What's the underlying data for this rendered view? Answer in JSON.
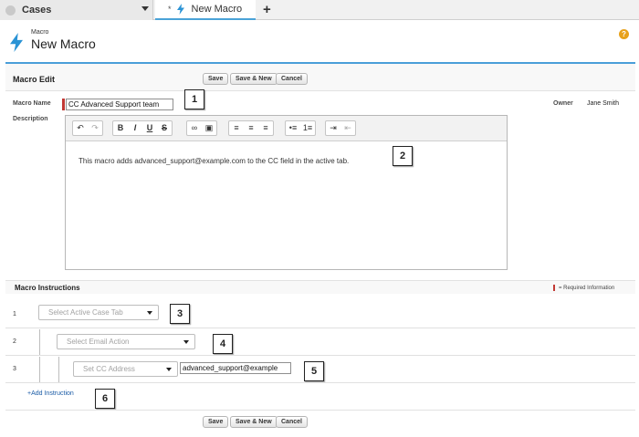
{
  "tabs": {
    "primary_label": "Cases",
    "subtab_modified_marker": "*",
    "subtab_label": "New Macro",
    "add_tab_symbol": "+"
  },
  "header": {
    "object_label": "Macro",
    "title": "New Macro",
    "help_symbol": "?"
  },
  "edit_section": {
    "title": "Macro Edit",
    "buttons": {
      "save": "Save",
      "save_new": "Save & New",
      "cancel": "Cancel"
    }
  },
  "fields": {
    "name_label": "Macro Name",
    "name_value": "CC Advanced Support team",
    "description_label": "Description",
    "owner_label": "Owner",
    "owner_value": "Jane Smith"
  },
  "editor": {
    "body_text": "This macro adds advanced_support@example.com to the CC field in the active tab.",
    "toolbar_icons": [
      "undo-icon",
      "redo-icon",
      "bold-icon",
      "italic-icon",
      "underline-icon",
      "strikethrough-icon",
      "link-icon",
      "image-icon",
      "align-left-icon",
      "align-center-icon",
      "align-right-icon",
      "bulleted-list-icon",
      "numbered-list-icon",
      "indent-icon",
      "outdent-icon"
    ]
  },
  "instructions": {
    "title": "Macro Instructions",
    "required_legend": "= Required Information",
    "rows": [
      {
        "number": "1",
        "select_value": "Select Active Case Tab"
      },
      {
        "number": "2",
        "select_value": "Select Email Action"
      },
      {
        "number": "3",
        "select_value": "Set CC Address",
        "input_value": "advanced_support@example"
      }
    ],
    "add_link": "+Add Instruction"
  },
  "footer": {
    "buttons": {
      "save": "Save",
      "save_new": "Save & New",
      "cancel": "Cancel"
    }
  },
  "callouts": [
    "1",
    "2",
    "3",
    "4",
    "5",
    "6"
  ],
  "colors": {
    "accent": "#4a9ed9",
    "required": "#c23934",
    "help": "#e8a11a",
    "link": "#1a5ba6"
  }
}
